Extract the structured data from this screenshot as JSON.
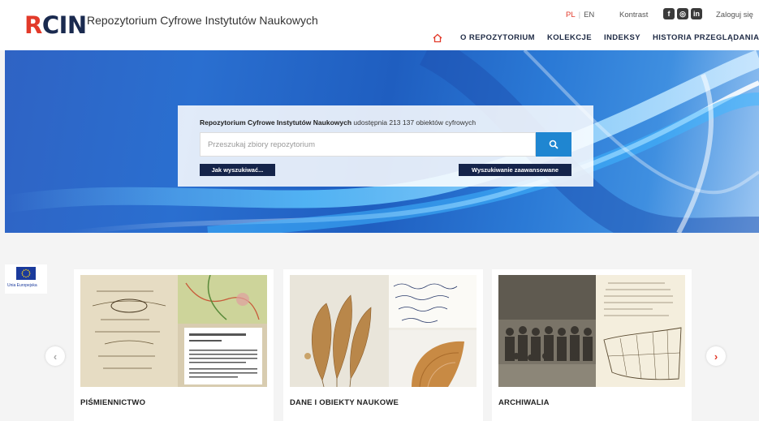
{
  "header": {
    "logo": {
      "r": "R",
      "rest": "CIN"
    },
    "subtitle": "Repozytorium Cyfrowe Instytutów Naukowych",
    "lang": {
      "pl": "PL",
      "en": "EN"
    },
    "contrast_label": "Kontrast",
    "social": {
      "facebook": "f",
      "instagram": "◎",
      "linkedin": "in"
    },
    "login_label": "Zaloguj się",
    "nav": [
      {
        "label": "O REPOZYTORIUM"
      },
      {
        "label": "KOLEKCJE"
      },
      {
        "label": "INDEKSY"
      },
      {
        "label": "HISTORIA PRZEGLĄDANIA"
      }
    ]
  },
  "hero": {
    "title_bold": "Repozytorium Cyfrowe Instytutów Naukowych",
    "title_rest": " udostępnia 213 137 obiektów cyfrowych",
    "search_placeholder": "Przeszukaj zbiory repozytorium",
    "howto_label": "Jak wyszukiwać...",
    "advanced_label": "Wyszukiwanie zaawansowane"
  },
  "eu": {
    "label": "Unia Europejska"
  },
  "carousel": {
    "cards": [
      {
        "title": "PIŚMIENNICTWO"
      },
      {
        "title": "DANE I OBIEKTY NAUKOWE"
      },
      {
        "title": "ARCHIWALIA"
      }
    ],
    "prev_icon": "‹",
    "next_icon": "›"
  },
  "colors": {
    "accent_red": "#e23a2a",
    "navy": "#15244a",
    "search_blue": "#1f86d1"
  }
}
